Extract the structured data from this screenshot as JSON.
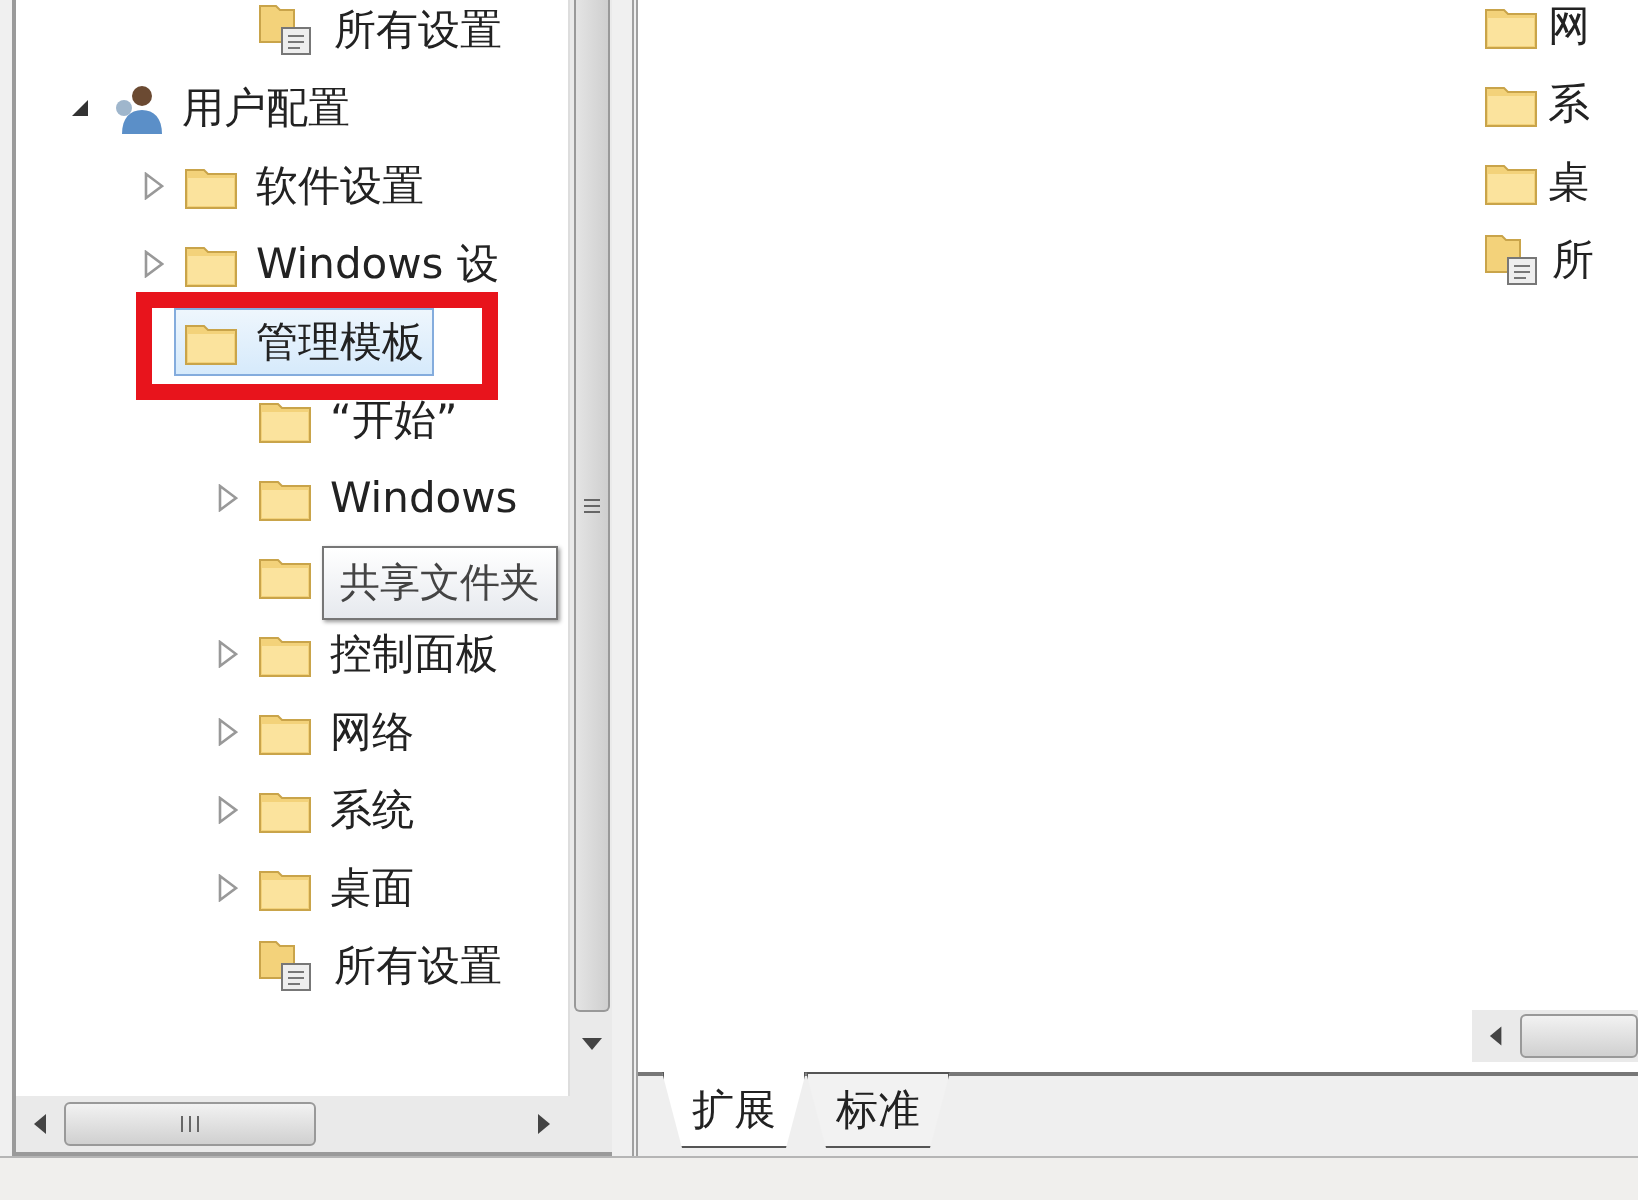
{
  "tree": [
    {
      "children": [
        {
          "children": [
            {
              "label": "所有设置",
              "kind": "settings"
            }
          ]
        }
      ]
    },
    {
      "label": "用户配置",
      "kind": "user",
      "expanded": true,
      "children": [
        {
          "label": "软件设置",
          "kind": "folder",
          "expanded": false
        },
        {
          "label": "Windows 设",
          "kind": "folder",
          "expanded": false
        },
        {
          "label": "管理模板",
          "kind": "folder",
          "selected": true,
          "marked": true,
          "children": [
            {
              "label": "“开始”",
              "kind": "folder",
              "selected": false
            },
            {
              "label": "Windows",
              "kind": "folder",
              "expanded": false,
              "selected": false
            },
            {
              "kind": "folder",
              "selected": false
            },
            {
              "label": "控制面板",
              "kind": "folder",
              "expanded": false,
              "selected": false
            },
            {
              "label": "网络",
              "kind": "folder",
              "expanded": false,
              "selected": false
            },
            {
              "label": "系统",
              "kind": "folder",
              "expanded": false,
              "selected": false
            },
            {
              "label": "桌面",
              "kind": "folder",
              "expanded": false,
              "selected": false
            },
            {
              "label": "所有设置",
              "kind": "settings",
              "selected": false
            }
          ]
        }
      ]
    }
  ],
  "tooltip": "共享文件夹",
  "details": [
    {
      "label": "网",
      "kind": "folder"
    },
    {
      "label": "系",
      "kind": "folder"
    },
    {
      "label": "桌",
      "kind": "folder"
    },
    {
      "label": "所",
      "kind": "settings"
    }
  ],
  "tabs": [
    {
      "label": "扩展",
      "selected": true
    },
    {
      "label": "标准",
      "selected": false
    }
  ]
}
